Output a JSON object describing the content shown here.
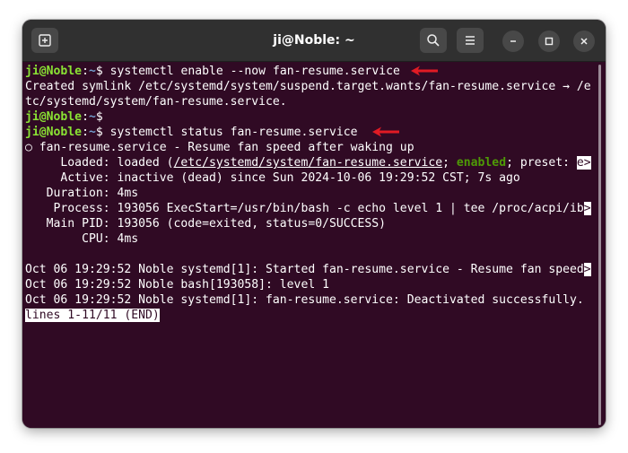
{
  "window": {
    "title": "ji@Noble: ~"
  },
  "terminal": {
    "lines": [
      {
        "user": "ji@Noble",
        "sep": ":",
        "cwd": "~",
        "sym": "$ ",
        "cmd": "systemctl enable --now fan-resume.service"
      },
      {
        "text": "Created symlink /etc/systemd/system/suspend.target.wants/fan-resume.service → /e"
      },
      {
        "text": "tc/systemd/system/fan-resume.service."
      },
      {
        "user": "ji@Noble",
        "sep": ":",
        "cwd": "~",
        "sym": "$",
        "cmd": ""
      },
      {
        "user": "ji@Noble",
        "sep": ":",
        "cwd": "~",
        "sym": "$ ",
        "cmd": "systemctl status fan-resume.service"
      },
      {
        "text": "○ fan-resume.service - Resume fan speed after waking up"
      },
      {
        "loaded_pre": "     Loaded: loaded (",
        "loaded_path": "/etc/systemd/system/fan-resume.service",
        "loaded_mid": "; ",
        "loaded_enabled": "enabled",
        "loaded_post": "; preset: ",
        "loaded_trunc": "e>"
      },
      {
        "text": "     Active: inactive (dead) since Sun 2024-10-06 19:29:52 CST; 7s ago"
      },
      {
        "text": "   Duration: 4ms"
      },
      {
        "text": "    Process: 193056 ExecStart=/usr/bin/bash -c echo level 1 | tee /proc/acpi/ib",
        "trunc": ">"
      },
      {
        "text": "   Main PID: 193056 (code=exited, status=0/SUCCESS)"
      },
      {
        "text": "        CPU: 4ms"
      },
      {
        "text": ""
      },
      {
        "text": "Oct 06 19:29:52 Noble systemd[1]: Started fan-resume.service - Resume fan speed",
        "trunc": ">"
      },
      {
        "text": "Oct 06 19:29:52 Noble bash[193058]: level 1"
      },
      {
        "text": "Oct 06 19:29:52 Noble systemd[1]: fan-resume.service: Deactivated successfully."
      }
    ],
    "pager_status": "lines 1-11/11 (END)"
  },
  "icons": {
    "new_tab": "new-tab-icon",
    "search": "search-icon",
    "menu": "hamburger-menu-icon",
    "minimize": "minimize-icon",
    "maximize": "maximize-icon",
    "close": "close-icon",
    "annotation": "red-arrow-icon"
  },
  "colors": {
    "terminal_bg": "#300a24",
    "titlebar_bg": "#303030",
    "prompt_user": "#8ae234",
    "prompt_cwd": "#729fcf",
    "enabled": "#4e9a06",
    "arrow": "#e01b24"
  }
}
